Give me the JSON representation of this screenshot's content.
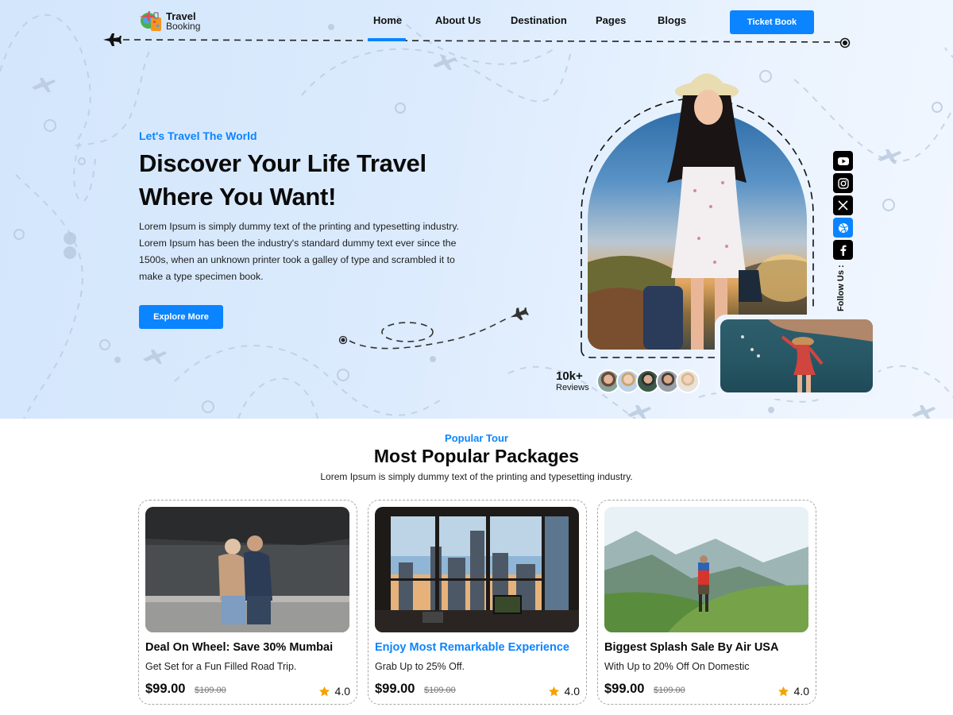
{
  "header": {
    "logo_title": "Travel",
    "logo_subtitle": "Booking",
    "nav": [
      {
        "label": "Home",
        "active": true
      },
      {
        "label": "About Us",
        "active": false
      },
      {
        "label": "Destination",
        "active": false
      },
      {
        "label": "Pages",
        "active": false
      },
      {
        "label": "Blogs",
        "active": false
      }
    ],
    "cta_label": "Ticket Book"
  },
  "hero": {
    "tagline": "Let's Travel The World",
    "headline": "Discover Your Life Travel Where You Want!",
    "description": "Lorem Ipsum is simply dummy text of the printing and typesetting industry. Lorem Ipsum has been the industry's standard dummy text ever since the 1500s, when an unknown printer took a galley of type and scrambled it to make a type specimen book.",
    "button_label": "Explore More",
    "reviews_count": "10k+",
    "reviews_label": "Reviews",
    "follow_label": "Follow Us :",
    "social": [
      {
        "name": "youtube",
        "icon": "youtube-icon"
      },
      {
        "name": "instagram",
        "icon": "instagram-icon"
      },
      {
        "name": "x",
        "icon": "x-icon"
      },
      {
        "name": "dribbble",
        "icon": "dribbble-icon",
        "active": true
      },
      {
        "name": "facebook",
        "icon": "facebook-icon"
      }
    ]
  },
  "popular": {
    "eyebrow": "Popular Tour",
    "title": "Most Popular Packages",
    "subtitle": "Lorem Ipsum is simply dummy text of the printing and typesetting industry.",
    "cards": [
      {
        "title": "Deal On Wheel: Save 30% Mumbai",
        "subtitle": "Get Set for a Fun Filled Road Trip.",
        "price": "$99.00",
        "old_price": "$109.00",
        "rating": "4.0",
        "highlight": false
      },
      {
        "title": "Enjoy Most Remarkable Experience",
        "subtitle": "Grab Up to 25% Off.",
        "price": "$99.00",
        "old_price": "$109.00",
        "rating": "4.0",
        "highlight": true
      },
      {
        "title": "Biggest Splash Sale By Air USA",
        "subtitle": "With Up to 20% Off On Domestic",
        "price": "$99.00",
        "old_price": "$109.00",
        "rating": "4.0",
        "highlight": false
      }
    ]
  },
  "colors": {
    "accent": "#0b84ff",
    "star": "#f5a300"
  }
}
